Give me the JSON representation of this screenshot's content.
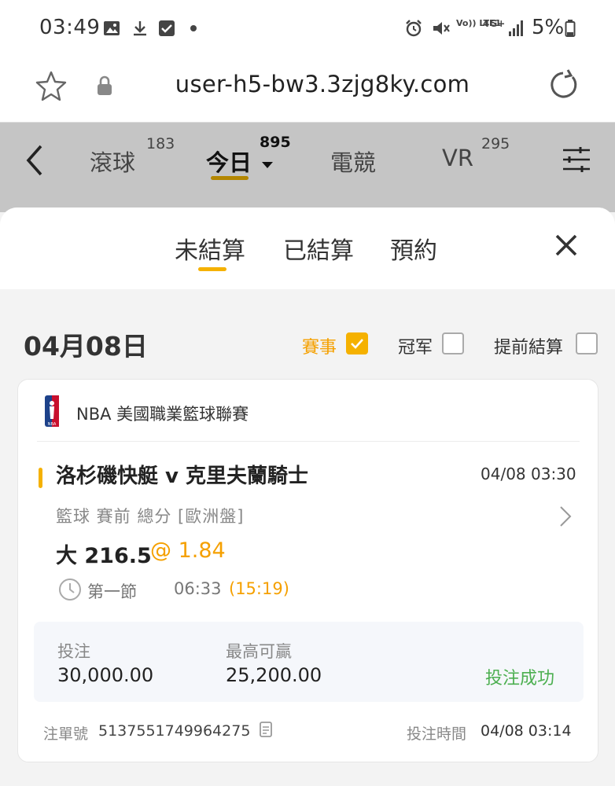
{
  "status_bar": {
    "time": "03:49",
    "icons": [
      "image-icon",
      "download-icon",
      "checkbox-icon",
      "dot-icon",
      "alarm-icon",
      "mute-icon",
      "volte-icon",
      "4g-icon",
      "signal-icon",
      "battery-icon"
    ],
    "volte": "Vo)) LTE1",
    "network": "4G+",
    "battery": "5%"
  },
  "browser": {
    "url": "user-h5-bw3.3zjg8ky.com"
  },
  "nav": {
    "tabs": [
      {
        "label": "滾球",
        "count": "183"
      },
      {
        "label": "今日",
        "count": "895"
      },
      {
        "label": "電競",
        "count": ""
      },
      {
        "label": "VR",
        "count": "295"
      }
    ],
    "active_tab": "今日",
    "accent": "#b38600"
  },
  "sheet": {
    "tabs": [
      "未結算",
      "已結算",
      "預約"
    ],
    "active_tab": "未結算",
    "date": "04月08日",
    "filters": [
      {
        "label": "賽事",
        "checked": true
      },
      {
        "label": "冠军",
        "checked": false
      },
      {
        "label": "提前結算",
        "checked": false
      }
    ]
  },
  "bet": {
    "league": "NBA 美國職業籃球聯賽",
    "match": "洛杉磯快艇 v 克里夫蘭騎士",
    "match_time": "04/08 03:30",
    "bet_type": "籃球  賽前   總分  [歐洲盤]",
    "pick": "大 216.5",
    "odds": "@ 1.84",
    "period": "第一節",
    "period_clock": "06:33",
    "period_remaining": "(15:19)",
    "stake_label": "投注",
    "stake": "30,000.00",
    "max_win_label": "最高可贏",
    "max_win": "25,200.00",
    "status": "投注成功",
    "ticket_label": "注單號",
    "ticket_no": "5137551749964275",
    "bet_time_label": "投注時間",
    "bet_time": "04/08 03:14"
  },
  "colors": {
    "accent_yellow": "#f5b100",
    "success_green": "#4caf50",
    "header_gray": "#c5c5c5"
  }
}
